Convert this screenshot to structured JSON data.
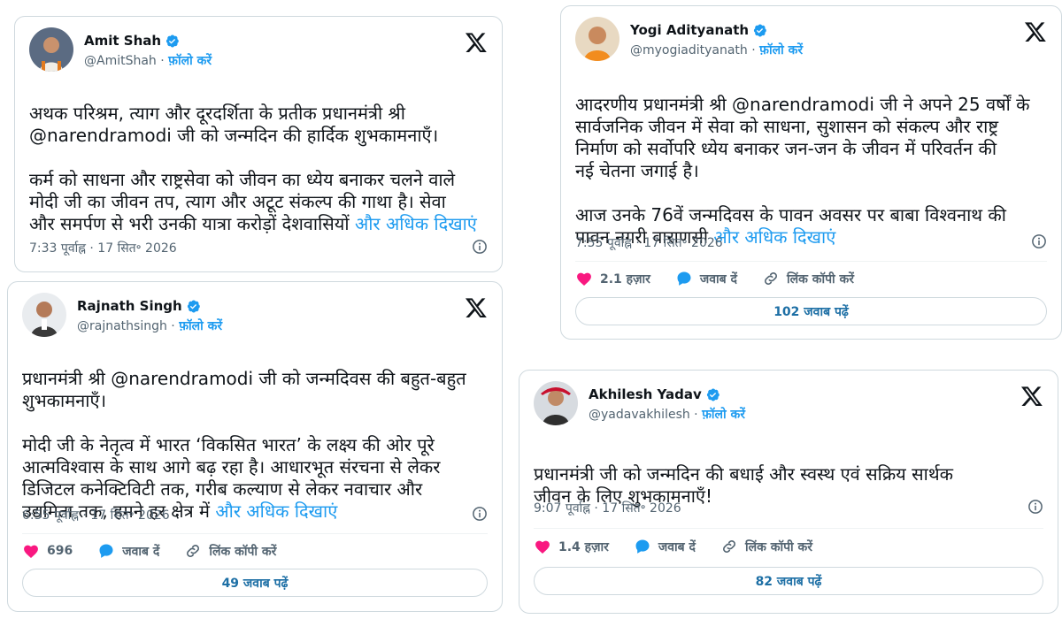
{
  "follow_label": "फ़ॉलो करें",
  "actions": {
    "reply": "जवाब दें",
    "copy": "लिंक कॉपी करें"
  },
  "colors": {
    "accent": "#1d9bf0",
    "like": "#f91880",
    "verified": "#1d9bf0"
  },
  "tweets": [
    {
      "name": "Amit Shah",
      "handle": "@AmitShah",
      "avatar_icon": "amit-shah-avatar",
      "text_main": "अथक परिश्रम, त्याग और दूरदर्शिता के प्रतीक प्रधानमंत्री श्री\n@narendramodi जी को जन्मदिन की हार्दिक शुभकामनाएँ।\n\nकर्म को साधना और राष्ट्रसेवा को जीवन का ध्येय बनाकर चलने वाले\nमोदी जी का जीवन तप, त्याग और अटूट संकल्प की गाथा है। सेवा\nऔर समर्पण से भरी उनकी यात्रा करोड़ों देशवासियों",
      "show_more": "और अधिक दिखाएं",
      "time": "7:33 पूर्वाह्न · 17 सित॰ 2026"
    },
    {
      "name": "Yogi Adityanath",
      "handle": "@myogiadityanath",
      "avatar_icon": "yogi-adityanath-avatar",
      "text_main": "आदरणीय प्रधानमंत्री श्री @narendramodi जी ने अपने 25 वर्षों के\nसार्वजनिक जीवन में सेवा को साधना, सुशासन को संकल्प और राष्ट्र\nनिर्माण को सर्वोपरि ध्येय बनाकर जन-जन के जीवन में परिवर्तन की\nनई चेतना जगाई है।\n\nआज उनके 76वें जन्मदिवस के पावन अवसर पर बाबा विश्वनाथ की\nपावन नगरी वाराणसी",
      "show_more": "और अधिक दिखाएं",
      "time": "7:55 पूर्वाह्न · 17 सित॰ 2026",
      "likes": "2.1 हज़ार",
      "read_replies": "102 जवाब पढ़ें"
    },
    {
      "name": "Rajnath Singh",
      "handle": "@rajnathsingh",
      "avatar_icon": "rajnath-singh-avatar",
      "text_main": "प्रधानमंत्री श्री @narendramodi जी को जन्मदिवस की बहुत-बहुत\nशुभकामनाएँ।\n\nमोदी जी के नेतृत्व में भारत ‘विकसित भारत’ के लक्ष्य की ओर पूरे\nआत्मविश्वास के साथ आगे बढ़ रहा है। आधारभूत संरचना से लेकर\nडिजिटल कनेक्टिविटी तक, गरीब कल्याण से लेकर नवाचार और\nउद्यमिता तक, हमने हर क्षेत्र में",
      "show_more": "और अधिक दिखाएं",
      "time": "6:55 पूर्वाह्न · 17 सित॰ 2026",
      "likes": "696",
      "read_replies": "49 जवाब पढ़ें"
    },
    {
      "name": "Akhilesh Yadav",
      "handle": "@yadavakhilesh",
      "avatar_icon": "akhilesh-yadav-avatar",
      "text_main": "प्रधानमंत्री जी को जन्मदिन की बधाई और स्वस्थ एवं सक्रिय सार्थक\nजीवन के लिए शुभकामनाएँ!",
      "show_more": "",
      "time": "9:07 पूर्वाह्न · 17 सित॰ 2026",
      "likes": "1.4 हज़ार",
      "read_replies": "82 जवाब पढ़ें"
    }
  ]
}
